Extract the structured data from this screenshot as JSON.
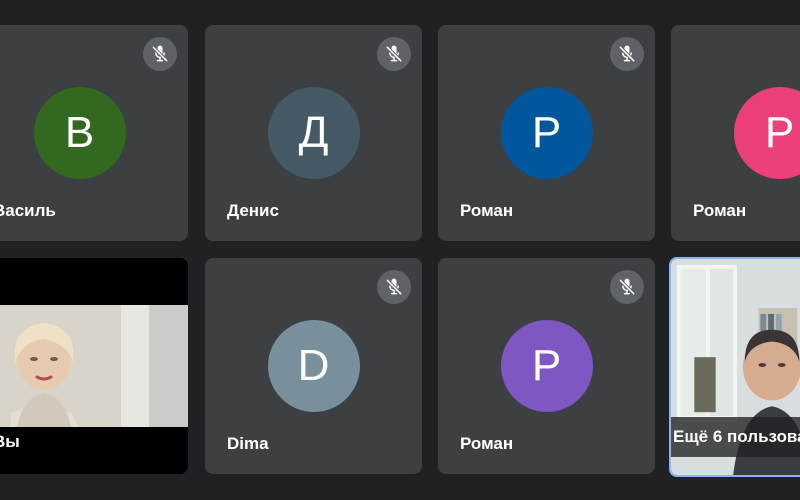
{
  "participants": [
    {
      "name": "Василь",
      "initial": "В",
      "color": "#33691e",
      "muted": true
    },
    {
      "name": "Денис",
      "initial": "Д",
      "color": "#455a64",
      "muted": true
    },
    {
      "name": "Роман",
      "initial": "Р",
      "color": "#01579b",
      "muted": true
    },
    {
      "name": "Роман",
      "initial": "Р",
      "color": "#ec407a",
      "muted": false
    },
    {
      "name": "Вы",
      "initial": "",
      "color": "#000000",
      "muted": false,
      "video": true
    },
    {
      "name": "Dima",
      "initial": "D",
      "color": "#78909c",
      "muted": true
    },
    {
      "name": "Роман",
      "initial": "Р",
      "color": "#7e57c2",
      "muted": true
    }
  ],
  "more_participants": {
    "label": "Ещё 6 пользова",
    "highlight_color": "#8ab4f8"
  },
  "icons": {
    "mute": "mic-off-icon"
  },
  "colors": {
    "background": "#202124",
    "tile": "#3c4043",
    "mute_badge": "#5f6368"
  }
}
